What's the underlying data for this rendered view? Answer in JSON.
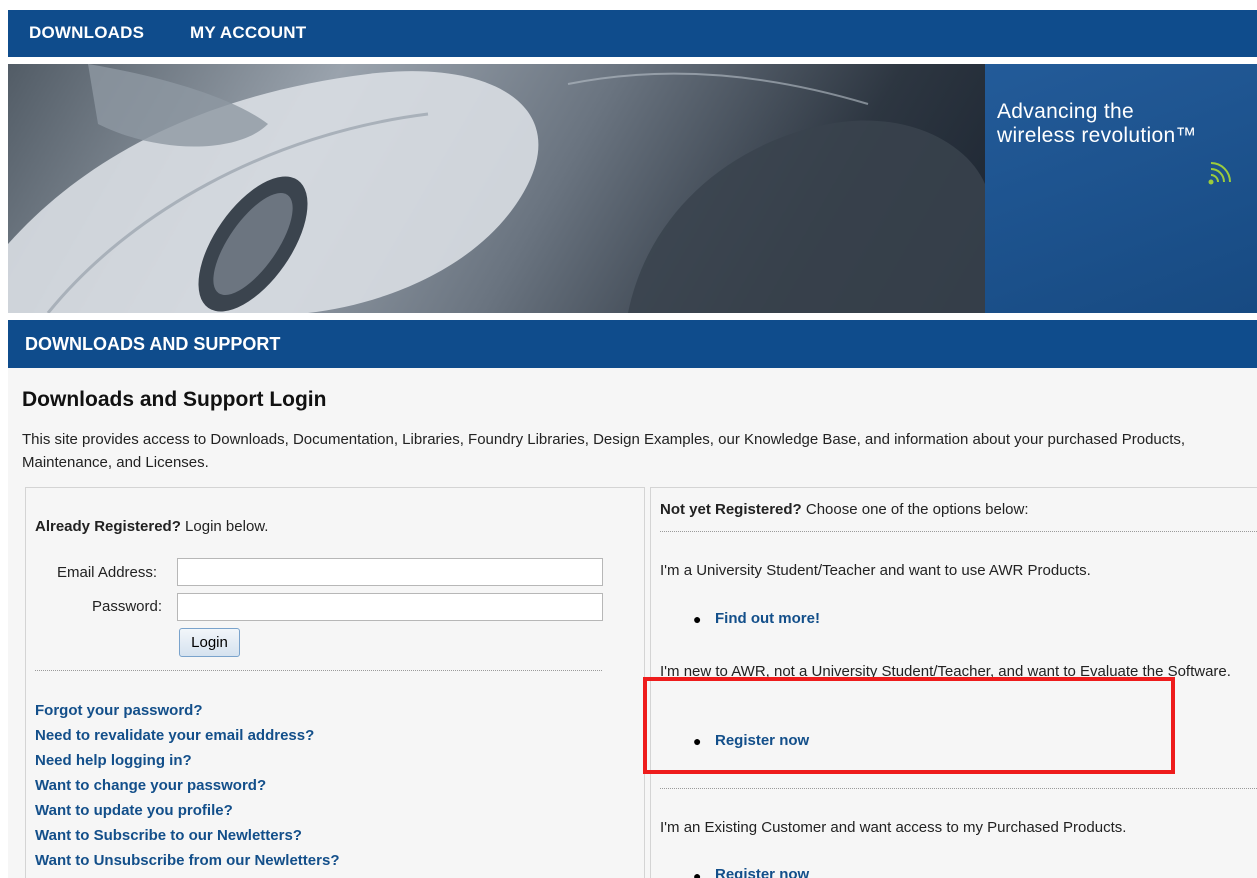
{
  "topnav": {
    "items": [
      "DOWNLOADS",
      "MY ACCOUNT"
    ]
  },
  "banner": {
    "tagline_line1": "Advancing the",
    "tagline_line2": "wireless revolution™"
  },
  "section": {
    "title": "DOWNLOADS AND SUPPORT"
  },
  "page": {
    "title": "Downloads and Support Login",
    "intro": "This site provides access to Downloads, Documentation, Libraries, Foundry Libraries, Design Examples, our Knowledge Base, and information about your purchased Products, Maintenance, and Licenses."
  },
  "login": {
    "heading_bold": "Already Registered?",
    "heading_rest": " Login below.",
    "email_label": "Email Address:",
    "email_value": "",
    "password_label": "Password:",
    "password_value": "",
    "button_label": "Login"
  },
  "help_links": [
    "Forgot your password?",
    "Need to revalidate your email address?",
    "Need help logging in?",
    "Want to change your password?",
    "Want to update you profile?",
    "Want to Subscribe to our Newletters?",
    "Want to Unsubscribe from our Newletters?"
  ],
  "register": {
    "heading_bold": "Not yet Registered?",
    "heading_rest": " Choose one of the options below:",
    "option1_text": "I'm a University Student/Teacher and want to use AWR Products.",
    "option1_link": "Find out more!",
    "option2_text": "I'm new to AWR, not a University Student/Teacher, and want to Evaluate the Software.",
    "option2_link": "Register now",
    "option3_text": "I'm an Existing Customer and want access to my Purchased Products.",
    "option3_link": "Register now"
  },
  "colors": {
    "nav": "#0f4c8c",
    "link": "#134f8a",
    "highlight": "#ee1c1c"
  }
}
